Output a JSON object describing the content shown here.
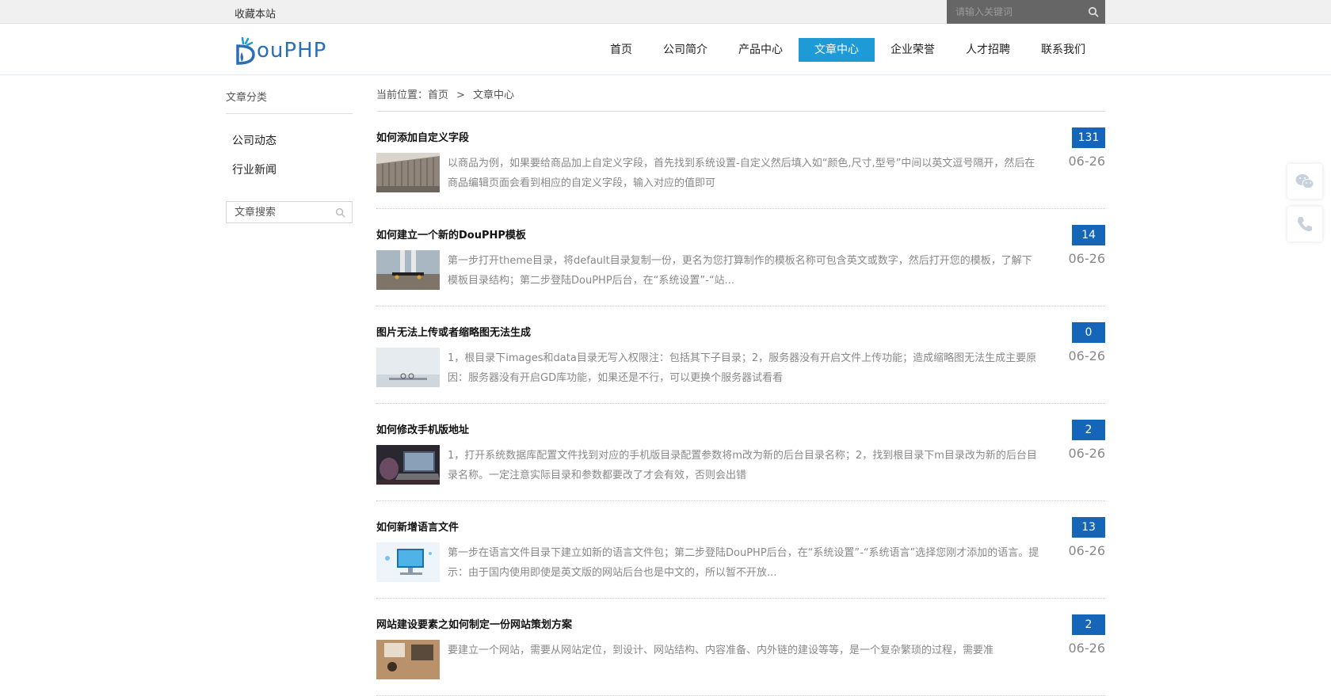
{
  "topbar": {
    "favorite_label": "收藏本站",
    "search_placeholder": "请输入关键词"
  },
  "logo": {
    "text": "ouPHP"
  },
  "nav": {
    "items": [
      {
        "label": "首页"
      },
      {
        "label": "公司简介"
      },
      {
        "label": "产品中心"
      },
      {
        "label": "文章中心"
      },
      {
        "label": "企业荣誉"
      },
      {
        "label": "人才招聘"
      },
      {
        "label": "联系我们"
      }
    ],
    "active_index": 3
  },
  "sidebar": {
    "title": "文章分类",
    "categories": [
      {
        "label": "公司动态"
      },
      {
        "label": "行业新闻"
      }
    ],
    "search_placeholder": "文章搜索"
  },
  "breadcrumb": {
    "prefix": "当前位置：",
    "home": "首页",
    "separator": ">",
    "current": "文章中心"
  },
  "articles": [
    {
      "title": "如何添加自定义字段",
      "desc": "以商品为例，如果要给商品加上自定义字段，首先找到系统设置-自定义然后填入如“颜色,尺寸,型号”中间以英文逗号隔开，然后在商品编辑页面会看到相应的自定义字段，输入对应的值即可",
      "count": "131",
      "date": "06-26",
      "thumb_icon": "building-thumbnail"
    },
    {
      "title": "如何建立一个新的DouPHP模板",
      "desc": "第一步打开theme目录，将default目录复制一份，更名为您打算制作的模板名称可包含英文或数字，然后打开您的模板，了解下模板目录结构；第二步登陆DouPHP后台，在“系统设置”-“站...",
      "count": "14",
      "date": "06-26",
      "thumb_icon": "skateboard-thumbnail"
    },
    {
      "title": "图片无法上传或者缩略图无法生成",
      "desc": "1，根目录下images和data目录无写入权限注：包括其下子目录；2，服务器没有开启文件上传功能；造成缩略图无法生成主要原因：服务器没有开启GD库功能，如果还是不行，可以更换个服务器试看看",
      "count": "0",
      "date": "06-26",
      "thumb_icon": "glasses-thumbnail"
    },
    {
      "title": "如何修改手机版地址",
      "desc": "1，打开系统数据库配置文件找到对应的手机版目录配置参数将m改为新的后台目录名称；2，找到根目录下m目录改为新的后台目录名称。一定注意实际目录和参数都要改了才会有效，否则会出错",
      "count": "2",
      "date": "06-26",
      "thumb_icon": "laptop-thumbnail"
    },
    {
      "title": "如何新增语言文件",
      "desc": "第一步在语言文件目录下建立如新的语言文件包；第二步登陆DouPHP后台，在“系统设置”-“系统语言”选择您刚才添加的语言。提示：由于国内使用即使是英文版的网站后台也是中文的，所以暂不开放...",
      "count": "13",
      "date": "06-26",
      "thumb_icon": "computer-thumbnail"
    },
    {
      "title": "网站建设要素之如何制定一份网站策划方案",
      "desc": "要建立一个网站，需要从网站定位，到设计、网站结构、内容准备、内外链的建设等等，是一个复杂繁琐的过程，需要准",
      "count": "2",
      "date": "06-26",
      "thumb_icon": "desk-thumbnail"
    }
  ],
  "floating": [
    {
      "icon": "wechat-icon"
    },
    {
      "icon": "phone-icon"
    }
  ],
  "colors": {
    "accent": "#1e9ad6",
    "count_badge": "#1566b8",
    "logo": "#2a6fb6"
  }
}
